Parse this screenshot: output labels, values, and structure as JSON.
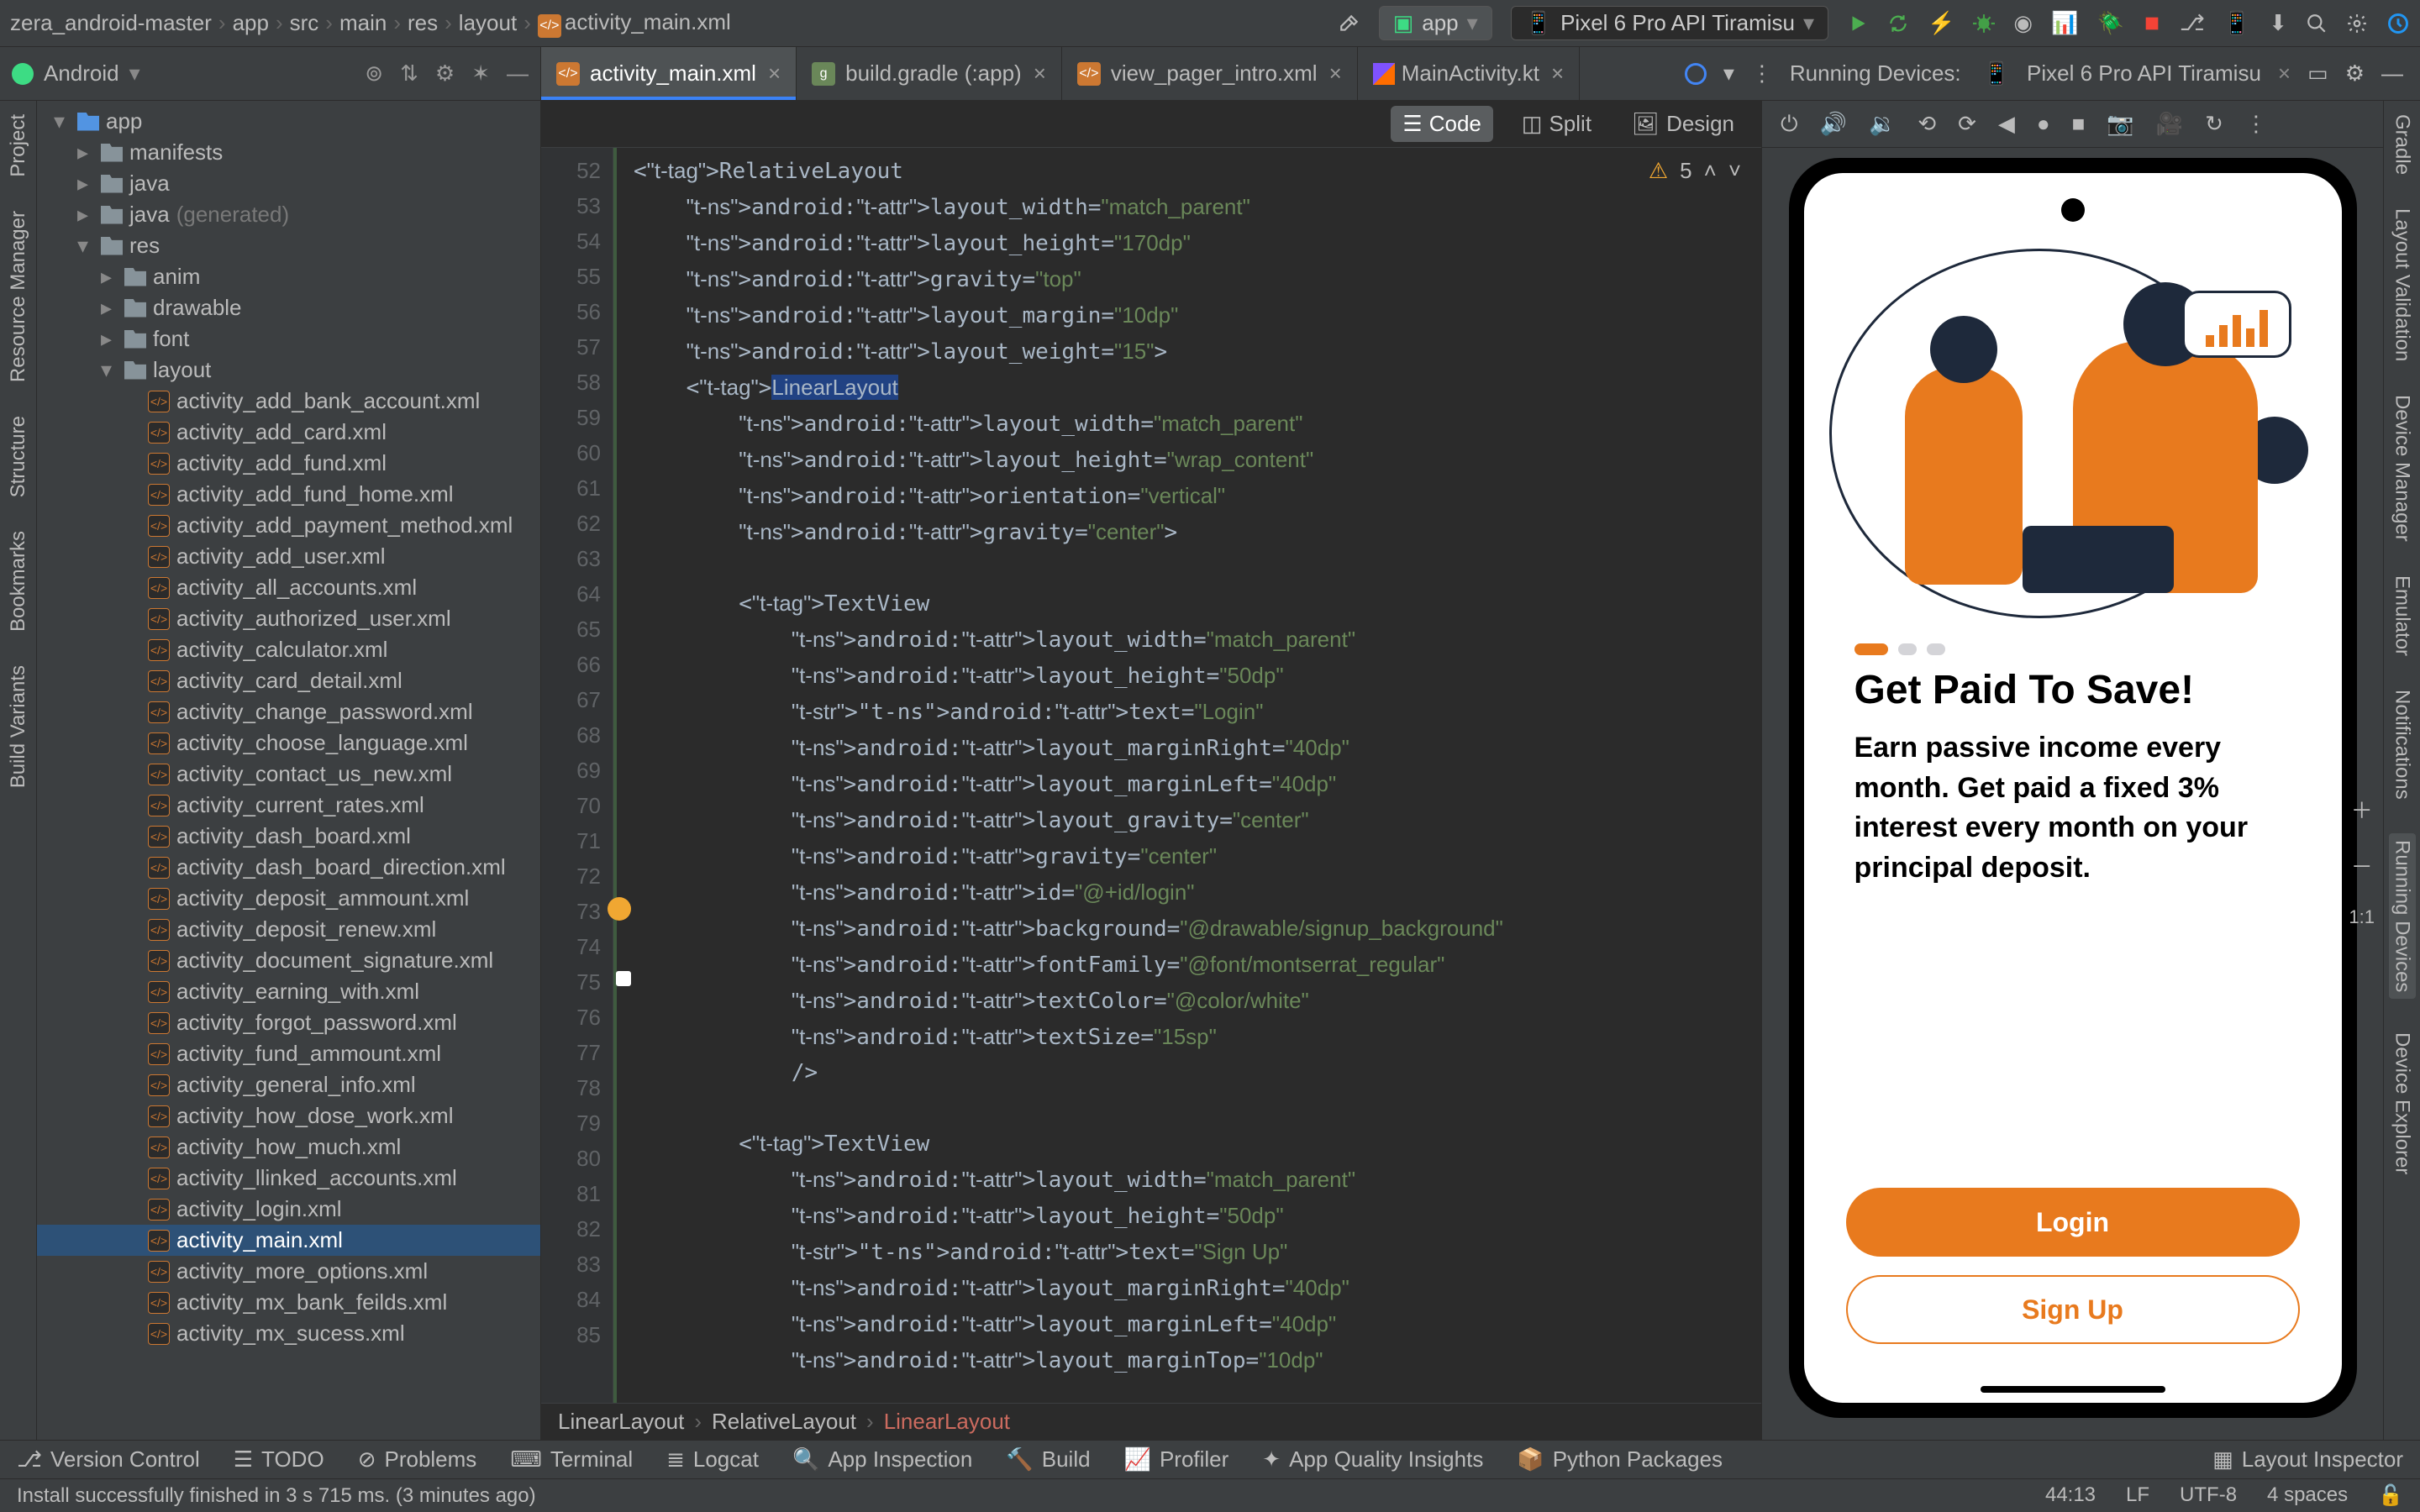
{
  "breadcrumbs": [
    "zera_android-master",
    "app",
    "src",
    "main",
    "res",
    "layout",
    "activity_main.xml"
  ],
  "toolbar": {
    "run_config": "app",
    "device": "Pixel 6 Pro API Tiramisu"
  },
  "tabs": {
    "running_devices_label": "Running Devices:",
    "running_device": "Pixel 6 Pro API Tiramisu",
    "items": [
      {
        "name": "activity_main.xml",
        "kind": "xml",
        "active": true
      },
      {
        "name": "build.gradle (:app)",
        "kind": "gradle",
        "active": false
      },
      {
        "name": "view_pager_intro.xml",
        "kind": "xml",
        "active": false
      },
      {
        "name": "MainActivity.kt",
        "kind": "kt",
        "active": false
      }
    ]
  },
  "left_panel": {
    "mode": "Android",
    "side_labels": [
      "Project",
      "Resource Manager",
      "Structure",
      "Bookmarks",
      "Build Variants"
    ]
  },
  "right_side_labels": [
    "Gradle",
    "Layout Validation",
    "Device Manager",
    "Emulator",
    "Notifications",
    "Running Devices",
    "Device Explorer"
  ],
  "tree": [
    {
      "d": 0,
      "chev": "▾",
      "ico": "mod",
      "label": "app"
    },
    {
      "d": 1,
      "chev": "▸",
      "ico": "dir",
      "label": "manifests"
    },
    {
      "d": 1,
      "chev": "▸",
      "ico": "dir",
      "label": "java"
    },
    {
      "d": 1,
      "chev": "▸",
      "ico": "dir",
      "label": "java",
      "suffix": "(generated)"
    },
    {
      "d": 1,
      "chev": "▾",
      "ico": "dir",
      "label": "res"
    },
    {
      "d": 2,
      "chev": "▸",
      "ico": "dir",
      "label": "anim"
    },
    {
      "d": 2,
      "chev": "▸",
      "ico": "dir",
      "label": "drawable"
    },
    {
      "d": 2,
      "chev": "▸",
      "ico": "dir",
      "label": "font"
    },
    {
      "d": 2,
      "chev": "▾",
      "ico": "dir",
      "label": "layout"
    },
    {
      "d": 3,
      "ico": "xml",
      "label": "activity_add_bank_account.xml"
    },
    {
      "d": 3,
      "ico": "xml",
      "label": "activity_add_card.xml"
    },
    {
      "d": 3,
      "ico": "xml",
      "label": "activity_add_fund.xml"
    },
    {
      "d": 3,
      "ico": "xml",
      "label": "activity_add_fund_home.xml"
    },
    {
      "d": 3,
      "ico": "xml",
      "label": "activity_add_payment_method.xml"
    },
    {
      "d": 3,
      "ico": "xml",
      "label": "activity_add_user.xml"
    },
    {
      "d": 3,
      "ico": "xml",
      "label": "activity_all_accounts.xml"
    },
    {
      "d": 3,
      "ico": "xml",
      "label": "activity_authorized_user.xml"
    },
    {
      "d": 3,
      "ico": "xml",
      "label": "activity_calculator.xml"
    },
    {
      "d": 3,
      "ico": "xml",
      "label": "activity_card_detail.xml"
    },
    {
      "d": 3,
      "ico": "xml",
      "label": "activity_change_password.xml"
    },
    {
      "d": 3,
      "ico": "xml",
      "label": "activity_choose_language.xml"
    },
    {
      "d": 3,
      "ico": "xml",
      "label": "activity_contact_us_new.xml"
    },
    {
      "d": 3,
      "ico": "xml",
      "label": "activity_current_rates.xml"
    },
    {
      "d": 3,
      "ico": "xml",
      "label": "activity_dash_board.xml"
    },
    {
      "d": 3,
      "ico": "xml",
      "label": "activity_dash_board_direction.xml"
    },
    {
      "d": 3,
      "ico": "xml",
      "label": "activity_deposit_ammount.xml"
    },
    {
      "d": 3,
      "ico": "xml",
      "label": "activity_deposit_renew.xml"
    },
    {
      "d": 3,
      "ico": "xml",
      "label": "activity_document_signature.xml"
    },
    {
      "d": 3,
      "ico": "xml",
      "label": "activity_earning_with.xml"
    },
    {
      "d": 3,
      "ico": "xml",
      "label": "activity_forgot_password.xml"
    },
    {
      "d": 3,
      "ico": "xml",
      "label": "activity_fund_ammount.xml"
    },
    {
      "d": 3,
      "ico": "xml",
      "label": "activity_general_info.xml"
    },
    {
      "d": 3,
      "ico": "xml",
      "label": "activity_how_dose_work.xml"
    },
    {
      "d": 3,
      "ico": "xml",
      "label": "activity_how_much.xml"
    },
    {
      "d": 3,
      "ico": "xml",
      "label": "activity_llinked_accounts.xml"
    },
    {
      "d": 3,
      "ico": "xml",
      "label": "activity_login.xml"
    },
    {
      "d": 3,
      "ico": "xml",
      "label": "activity_main.xml",
      "sel": true
    },
    {
      "d": 3,
      "ico": "xml",
      "label": "activity_more_options.xml"
    },
    {
      "d": 3,
      "ico": "xml",
      "label": "activity_mx_bank_feilds.xml"
    },
    {
      "d": 3,
      "ico": "xml",
      "label": "activity_mx_sucess.xml"
    }
  ],
  "editor": {
    "view_modes": {
      "code": "Code",
      "split": "Split",
      "design": "Design"
    },
    "warnings_count": "5",
    "lines_start": 52,
    "code_lines": [
      "<RelativeLayout",
      "    android:layout_width=\"match_parent\"",
      "    android:layout_height=\"170dp\"",
      "    android:gravity=\"top\"",
      "    android:layout_margin=\"10dp\"",
      "    android:layout_weight=\"15\">",
      "    <LinearLayout",
      "        android:layout_width=\"match_parent\"",
      "        android:layout_height=\"wrap_content\"",
      "        android:orientation=\"vertical\"",
      "        android:gravity=\"center\">",
      "",
      "        <TextView",
      "            android:layout_width=\"match_parent\"",
      "            android:layout_height=\"50dp\"",
      "            android:text=\"Login\"",
      "            android:layout_marginRight=\"40dp\"",
      "            android:layout_marginLeft=\"40dp\"",
      "            android:layout_gravity=\"center\"",
      "            android:gravity=\"center\"",
      "            android:id=\"@+id/login\"",
      "            android:background=\"@drawable/signup_background\"",
      "            android:fontFamily=\"@font/montserrat_regular\"",
      "            android:textColor=\"@color/white\"",
      "            android:textSize=\"15sp\"",
      "            />",
      "",
      "        <TextView",
      "            android:layout_width=\"match_parent\"",
      "            android:layout_height=\"50dp\"",
      "            android:text=\"Sign Up\"",
      "            android:layout_marginRight=\"40dp\"",
      "            android:layout_marginLeft=\"40dp\"",
      "            android:layout_marginTop=\"10dp\""
    ],
    "breadcrumb": [
      "LinearLayout",
      "RelativeLayout",
      "LinearLayout"
    ]
  },
  "emulator": {
    "title": "Get Paid To Save!",
    "body": "Earn passive income every month. Get paid a fixed 3% interest every month on your principal deposit.",
    "login": "Login",
    "signup": "Sign Up",
    "zoom": "1:1"
  },
  "bottom_tools": [
    "Version Control",
    "TODO",
    "Problems",
    "Terminal",
    "Logcat",
    "App Inspection",
    "Build",
    "Profiler",
    "App Quality Insights",
    "Python Packages"
  ],
  "bottom_right": "Layout Inspector",
  "status": {
    "msg": "Install successfully finished in 3 s 715 ms. (3 minutes ago)",
    "pos": "44:13",
    "lf": "LF",
    "enc": "UTF-8",
    "indent": "4 spaces"
  }
}
